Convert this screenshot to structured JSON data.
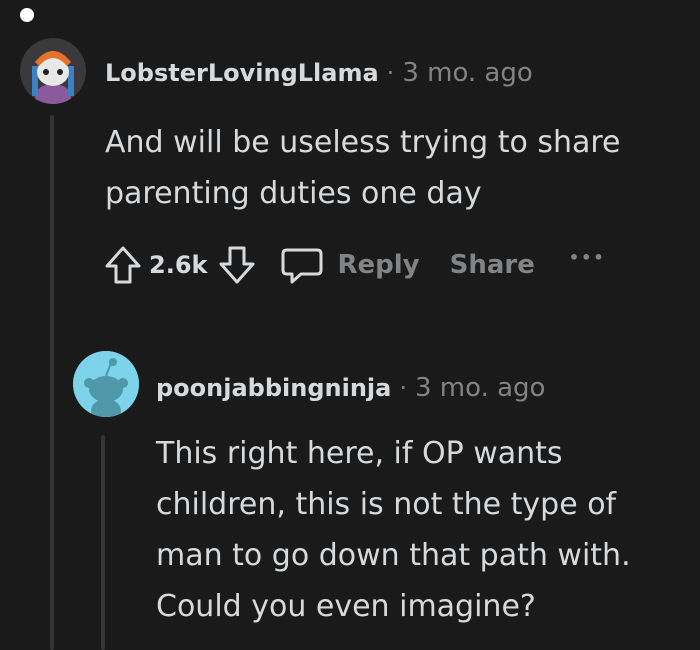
{
  "comments": [
    {
      "username": "LobsterLovingLlama",
      "separator": "·",
      "timestamp": "3 mo. ago",
      "body": "And will be useless trying to share parenting duties one day",
      "score": "2.6k",
      "reply_label": "Reply",
      "share_label": "Share",
      "more_label": "•••"
    },
    {
      "username": "poonjabbingninja",
      "separator": "·",
      "timestamp": "3 mo. ago",
      "body": "This right here, if OP wants children, this is not the type of man to go down that path with. Could you even imagine?"
    }
  ],
  "colors": {
    "background": "#1a1a1b",
    "text": "#d7dadc",
    "muted": "#818384",
    "avatar2_bg": "#7dd3ea"
  },
  "icons": [
    "upvote-icon",
    "downvote-icon",
    "comment-icon",
    "more-icon",
    "snoo-avatar-icon"
  ]
}
